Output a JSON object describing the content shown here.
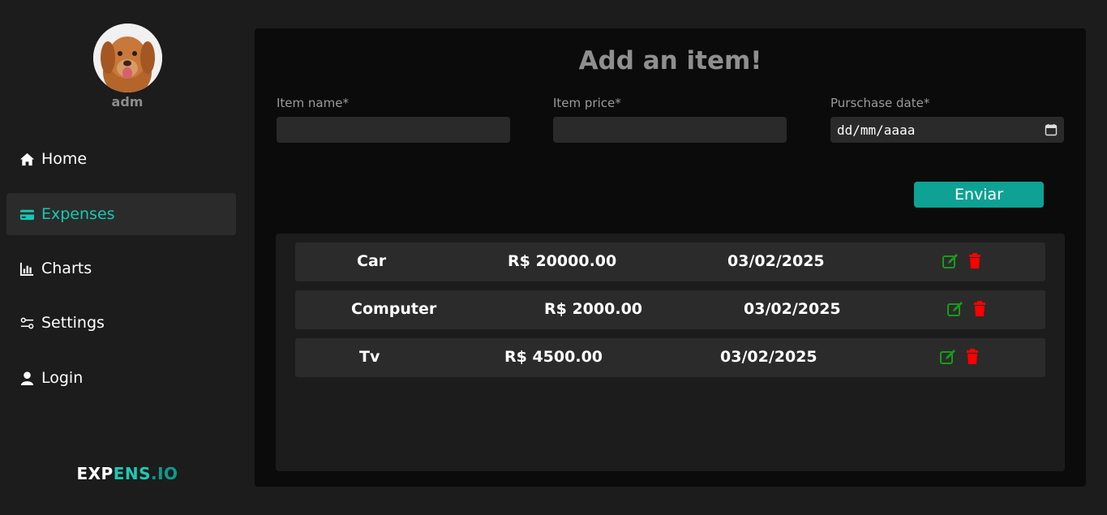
{
  "user": {
    "name": "adm"
  },
  "nav": [
    {
      "label": "Home",
      "icon": "home-icon"
    },
    {
      "label": "Expenses",
      "icon": "credit-card-icon",
      "active": true
    },
    {
      "label": "Charts",
      "icon": "bar-chart-icon"
    },
    {
      "label": "Settings",
      "icon": "sliders-icon"
    },
    {
      "label": "Login",
      "icon": "user-icon"
    }
  ],
  "brand": {
    "part1": "EXP",
    "part2": "ENS",
    "part3": ".IO"
  },
  "form": {
    "title": "Add an item!",
    "name_label": "Item name*",
    "name_value": "",
    "price_label": "Item price*",
    "price_value": "",
    "date_label": "Purschase date*",
    "date_placeholder": "dd/mm/aaaa",
    "submit_label": "Enviar"
  },
  "items": [
    {
      "name": "Car",
      "price": "R$ 20000.00",
      "date": "03/02/2025"
    },
    {
      "name": "Computer",
      "price": "R$ 2000.00",
      "date": "03/02/2025"
    },
    {
      "name": "Tv",
      "price": "R$ 4500.00",
      "date": "03/02/2025"
    }
  ],
  "colors": {
    "accent": "#16c8b4",
    "button": "#0ea294",
    "edit": "#1a9a1a",
    "delete": "#ff0000"
  }
}
